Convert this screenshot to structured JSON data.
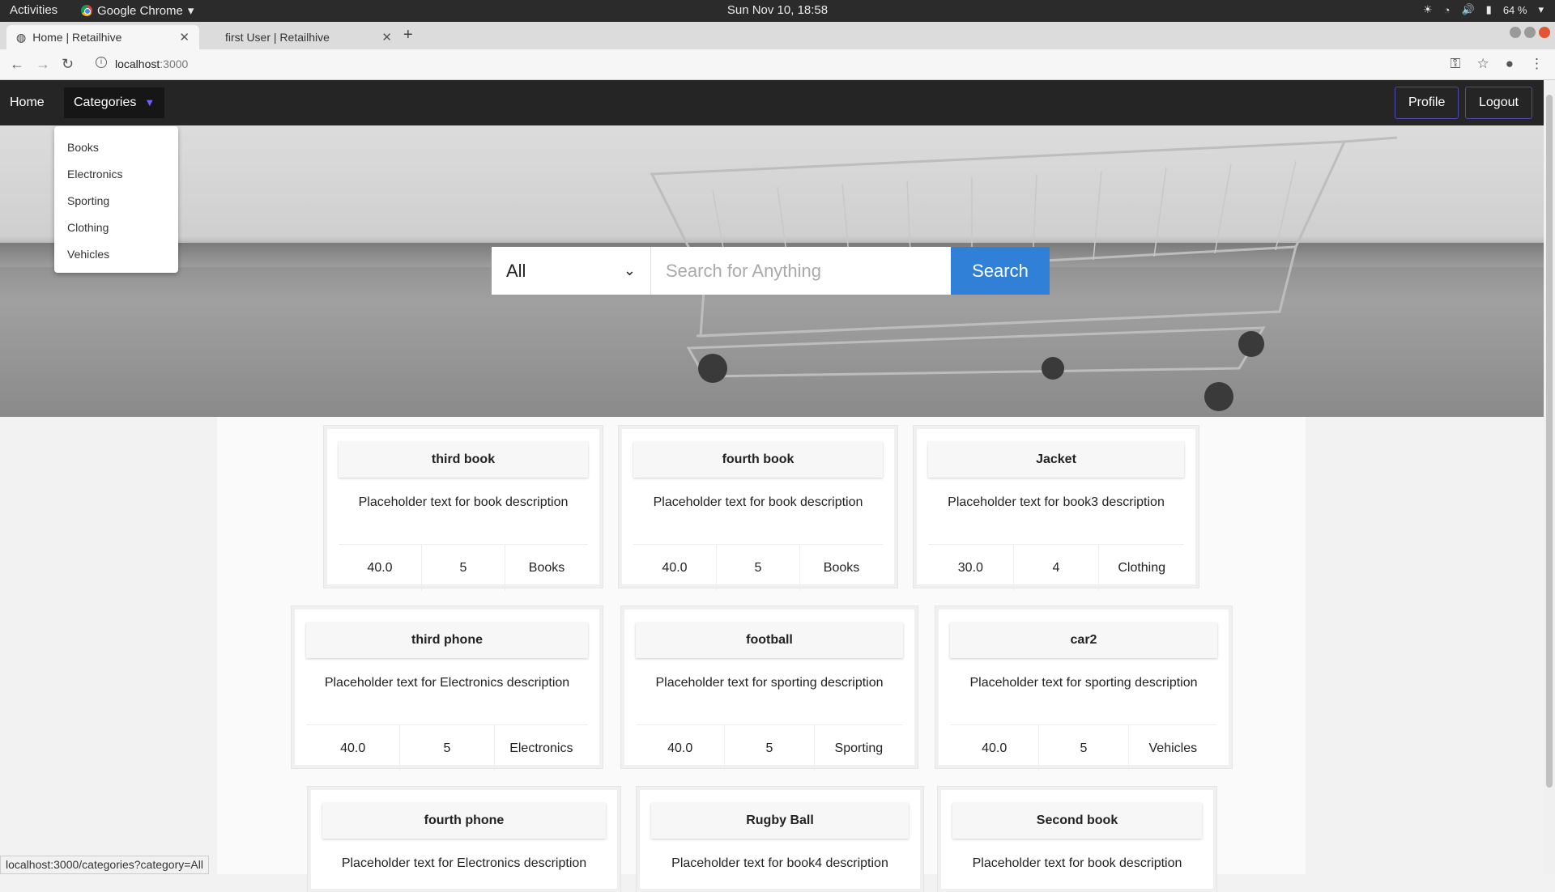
{
  "system": {
    "activities": "Activities",
    "app_name": "Google Chrome",
    "clock": "Sun Nov 10, 18:58",
    "battery": "64 %"
  },
  "tabs": [
    {
      "title": "Home | Retailhive",
      "active": true
    },
    {
      "title": "first User | Retailhive",
      "active": false
    }
  ],
  "address": {
    "host": "localhost",
    "port": ":3000"
  },
  "navbar": {
    "home": "Home",
    "categories": "Categories",
    "profile": "Profile",
    "logout": "Logout"
  },
  "dropdown": [
    "Books",
    "Electronics",
    "Sporting",
    "Clothing",
    "Vehicles"
  ],
  "search": {
    "category": "All",
    "placeholder": "Search for Anything",
    "button": "Search"
  },
  "products": [
    {
      "name": "third book",
      "description": "Placeholder text for book description",
      "price": "40.0",
      "qty": "5",
      "category": "Books"
    },
    {
      "name": "fourth book",
      "description": "Placeholder text for book description",
      "price": "40.0",
      "qty": "5",
      "category": "Books"
    },
    {
      "name": "Jacket",
      "description": "Placeholder text for book3 description",
      "price": "30.0",
      "qty": "4",
      "category": "Clothing"
    },
    {
      "name": "third phone",
      "description": "Placeholder text for Electronics description",
      "price": "40.0",
      "qty": "5",
      "category": "Electronics"
    },
    {
      "name": "football",
      "description": "Placeholder text for sporting description",
      "price": "40.0",
      "qty": "5",
      "category": "Sporting"
    },
    {
      "name": "car2",
      "description": "Placeholder text for sporting description",
      "price": "40.0",
      "qty": "5",
      "category": "Vehicles"
    },
    {
      "name": "fourth phone",
      "description": "Placeholder text for Electronics description",
      "price": "",
      "qty": "",
      "category": ""
    },
    {
      "name": "Rugby Ball",
      "description": "Placeholder text for book4 description",
      "price": "",
      "qty": "",
      "category": ""
    },
    {
      "name": "Second book",
      "description": "Placeholder text for book description",
      "price": "",
      "qty": "",
      "category": ""
    }
  ],
  "status_url": "localhost:3000/categories?category=All",
  "colors": {
    "accent": "#2f80d6",
    "navbar": "#252525",
    "outline": "#4a4ab0"
  }
}
